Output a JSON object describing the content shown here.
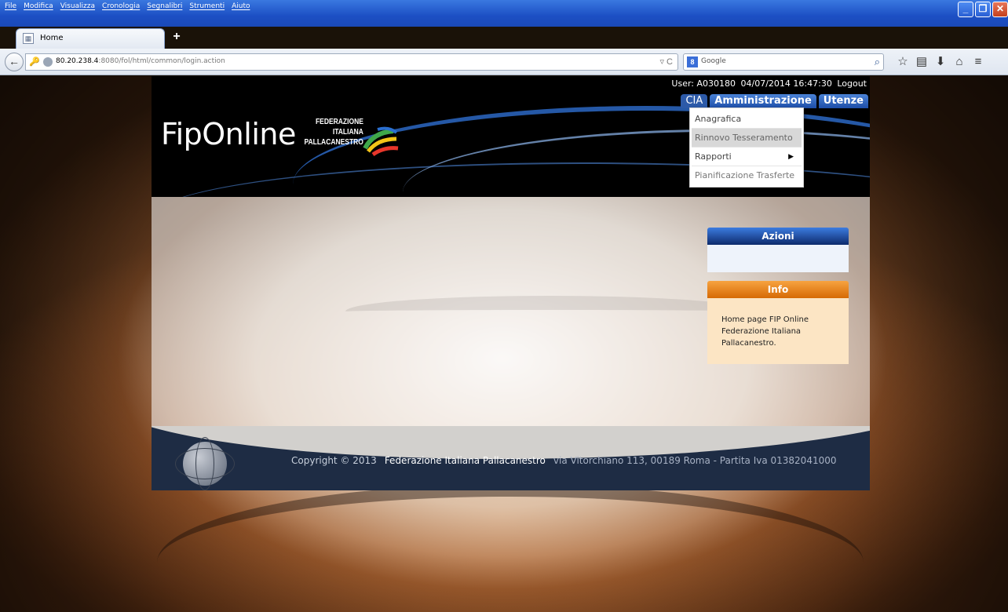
{
  "menubar": [
    "File",
    "Modifica",
    "Visualizza",
    "Cronologia",
    "Segnalibri",
    "Strumenti",
    "Aiuto"
  ],
  "tab": {
    "title": "Home"
  },
  "url": {
    "host": "80.20.238.4",
    "path": ":8080/fol/html/common/login.action"
  },
  "search": {
    "placeholder": "Google",
    "engine": "8"
  },
  "header": {
    "logo": "FipOnline",
    "federazione_1": "FEDERAZIONE",
    "federazione_2": "ITALIANA",
    "federazione_3": "PALLACANESTRO"
  },
  "user": {
    "label": "User: A030180",
    "datetime": "04/07/2014 16:47:30",
    "logout": "Logout"
  },
  "topmenu": [
    "CIA",
    "Amministrazione",
    "Utenze"
  ],
  "dropdown": [
    "Anagrafica",
    "Rinnovo Tesseramento",
    "Rapporti",
    "Pianificazione Trasferte"
  ],
  "azioni": {
    "title": "Azioni"
  },
  "info": {
    "title": "Info",
    "line1": "Home page FIP Online",
    "line2": "Federazione Italiana",
    "line3": "Pallacanestro."
  },
  "footer": {
    "copyright": "Copyright © 2013",
    "federazione": "Federazione Italiana Pallacanestro",
    "address": "via Vitorchiano 113, 00189 Roma - Partita Iva 01382041000"
  }
}
